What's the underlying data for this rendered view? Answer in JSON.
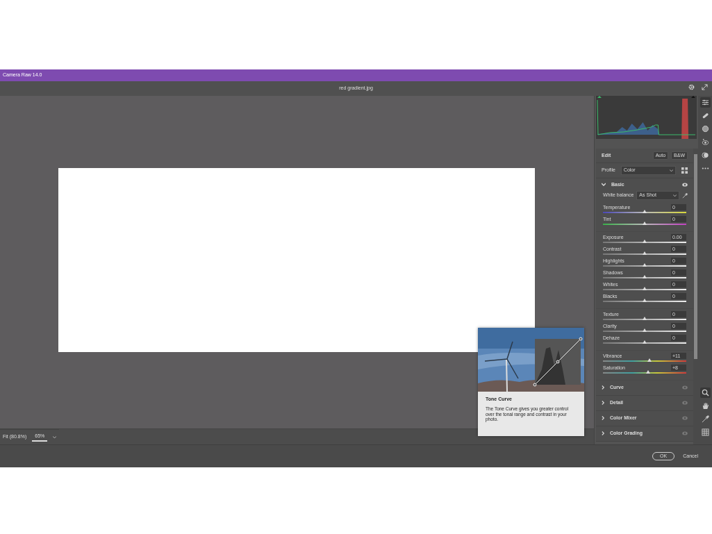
{
  "window": {
    "title": "Camera Raw 14.0"
  },
  "toolbar": {
    "filename": "red gradient.jpg"
  },
  "zoom_bar": {
    "fit": "Fit (80.8%)",
    "zoom": "65%"
  },
  "edit": {
    "title": "Edit",
    "buttons": [
      "Auto",
      "B&W"
    ]
  },
  "profile": {
    "label": "Profile",
    "value": "Color"
  },
  "basic": {
    "title": "Basic",
    "expanded": true,
    "white_balance": {
      "label": "White balance",
      "value": "As Shot"
    },
    "groups": [
      [
        {
          "label": "Temperature",
          "value": "0",
          "level": 0.5,
          "kind": "temperature"
        },
        {
          "label": "Tint",
          "value": "0",
          "level": 0.5,
          "kind": "tint"
        }
      ],
      [
        {
          "label": "Exposure",
          "value": "0.00",
          "level": 0.5,
          "kind": "tone"
        },
        {
          "label": "Contrast",
          "value": "0",
          "level": 0.5,
          "kind": "tone"
        },
        {
          "label": "Highlights",
          "value": "0",
          "level": 0.5,
          "kind": "tone"
        },
        {
          "label": "Shadows",
          "value": "0",
          "level": 0.5,
          "kind": "tone"
        },
        {
          "label": "Whites",
          "value": "0",
          "level": 0.5,
          "kind": "tone"
        },
        {
          "label": "Blacks",
          "value": "0",
          "level": 0.5,
          "kind": "tone"
        }
      ],
      [
        {
          "label": "Texture",
          "value": "0",
          "level": 0.5,
          "kind": "tone"
        },
        {
          "label": "Clarity",
          "value": "0",
          "level": 0.5,
          "kind": "tone"
        },
        {
          "label": "Dehaze",
          "value": "0",
          "level": 0.5,
          "kind": "tone"
        }
      ],
      [
        {
          "label": "Vibrance",
          "value": "+11",
          "level": 0.56,
          "kind": "color"
        },
        {
          "label": "Saturation",
          "value": "+8",
          "level": 0.54,
          "kind": "color"
        }
      ]
    ]
  },
  "sections": [
    {
      "title": "Curve",
      "expanded": false
    },
    {
      "title": "Detail",
      "expanded": false
    },
    {
      "title": "Color Mixer",
      "expanded": false
    },
    {
      "title": "Color Grading",
      "expanded": false
    }
  ],
  "tools_top": [
    {
      "selected": true
    },
    {
      "selected": false
    },
    {
      "selected": false
    },
    {
      "selected": false
    },
    {
      "selected": false
    },
    {
      "selected": false
    }
  ],
  "tools_bottom": [
    {
      "selected": true
    },
    {
      "selected": false
    },
    {
      "selected": false
    },
    {
      "selected": false
    }
  ],
  "tooltip": {
    "title": "Tone Curve",
    "text": "The Tone Curve gives you greater control over the tonal range and contrast in your photo."
  },
  "footer": {
    "buttons": [
      "OK",
      "Cancel"
    ]
  }
}
